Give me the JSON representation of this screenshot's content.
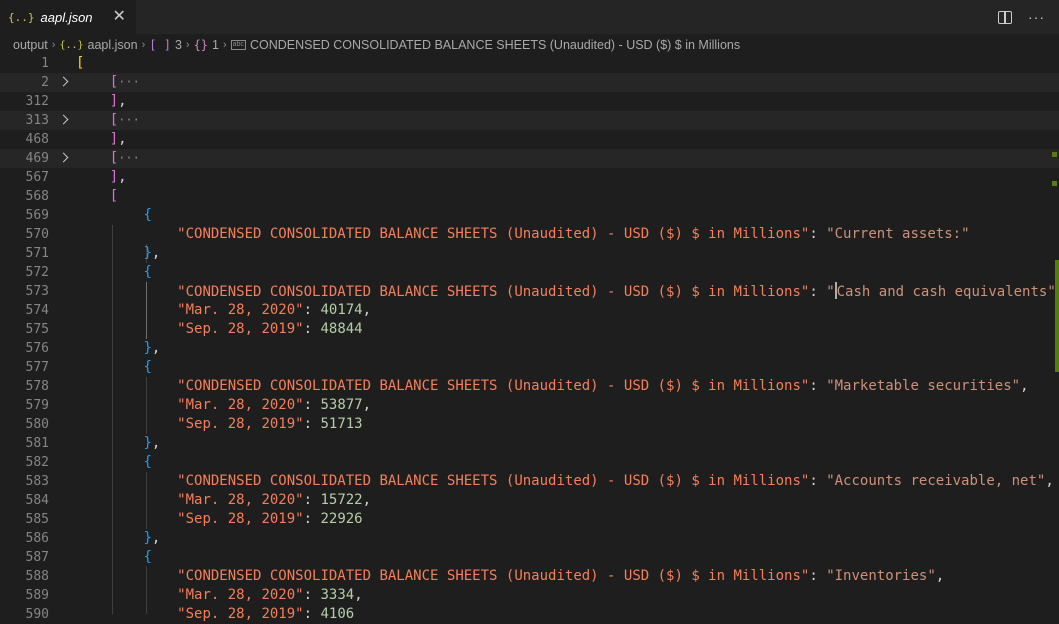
{
  "tab": {
    "icon": "{..}",
    "title": "aapl.json",
    "close": "✕"
  },
  "breadcrumb": {
    "folder": "output",
    "file_icon": "{..}",
    "file": "aapl.json",
    "array_icon": "[ ]",
    "array_index": "3",
    "object_icon": "{}",
    "object_index": "1",
    "string_icon": "abc",
    "key": "CONDENSED CONSOLIDATED BALANCE SHEETS (Unaudited) - USD ($) $ in Millions"
  },
  "editor": {
    "key_text": "CONDENSED CONSOLIDATED BALANCE SHEETS (Unaudited) - USD ($) $ in Millions",
    "date1": "Mar. 28, 2020",
    "date2": "Sep. 28, 2019",
    "line_numbers": [
      "1",
      "2",
      "312",
      "313",
      "468",
      "469",
      "567",
      "568",
      "569",
      "570",
      "571",
      "572",
      "573",
      "574",
      "575",
      "576",
      "577",
      "578",
      "579",
      "580",
      "581",
      "582",
      "583",
      "584",
      "585",
      "586",
      "587",
      "588",
      "589",
      "590"
    ],
    "values": {
      "current_assets": "Current assets:",
      "cash": "Cash and cash equivalents",
      "cash_mar": "40174",
      "cash_sep": "48844",
      "marketable": "Marketable securities",
      "marketable_mar": "53877",
      "marketable_sep": "51713",
      "receivable": "Accounts receivable, net",
      "receivable_mar": "15722",
      "receivable_sep": "22926",
      "inventories": "Inventories",
      "inventories_mar": "3334",
      "inventories_sep": "4106"
    },
    "ellipsis": "···"
  },
  "colors": {
    "background": "#1e1e1e",
    "string": "#ce9178",
    "number": "#b5cea8",
    "bracket_level1": "#ffd700",
    "bracket_level2": "#da70d6",
    "bracket_level3": "#179fff"
  }
}
